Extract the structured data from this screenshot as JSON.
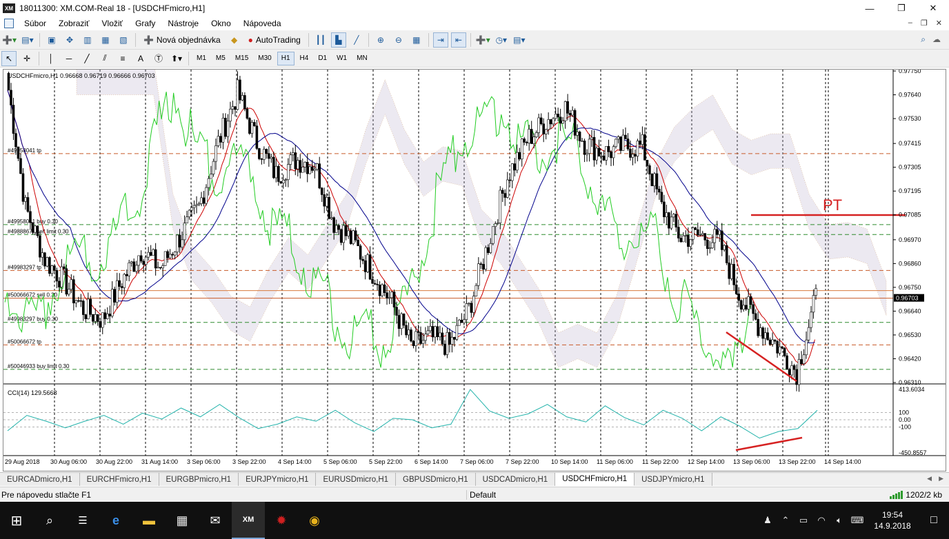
{
  "window": {
    "title": "18011300: XM.COM-Real 18 - [USDCHFmicro,H1]",
    "logo": "XM"
  },
  "menu": [
    "Súbor",
    "Zobraziť",
    "Vložiť",
    "Grafy",
    "Nástroje",
    "Okno",
    "Nápoveda"
  ],
  "toolbar": {
    "new_order": "Nová objednávka",
    "autotrading": "AutoTrading"
  },
  "timeframes": [
    "M1",
    "M5",
    "M15",
    "M30",
    "H1",
    "H4",
    "D1",
    "W1",
    "MN"
  ],
  "active_timeframe": "H1",
  "chart": {
    "header": "USDCHFmicro,H1  0.96668 0.96719 0.96666 0.96703",
    "current_price": "0.96703",
    "annotation_text": "PT",
    "price_ticks": [
      "0.97750",
      "0.97640",
      "0.97530",
      "0.97415",
      "0.97305",
      "0.97195",
      "0.97085",
      "0.96970",
      "0.96860",
      "0.96750",
      "0.96640",
      "0.96530",
      "0.96420",
      "0.96310"
    ],
    "time_ticks": [
      "29 Aug 2018",
      "30 Aug 06:00",
      "30 Aug 22:00",
      "31 Aug 14:00",
      "3 Sep 06:00",
      "3 Sep 22:00",
      "4 Sep 14:00",
      "5 Sep 06:00",
      "5 Sep 22:00",
      "6 Sep 14:00",
      "7 Sep 06:00",
      "7 Sep 22:00",
      "10 Sep 14:00",
      "11 Sep 06:00",
      "11 Sep 22:00",
      "12 Sep 14:00",
      "13 Sep 06:00",
      "13 Sep 22:00",
      "14 Sep 14:00"
    ],
    "order_labels": [
      "#49958041 tp",
      "#49958041 buy 0.30",
      "#49888677 sell limit 0.30",
      "#49983297 tp",
      "#50066672 sell 0.30",
      "#49983297 buy 0.30",
      "#50066672 tp",
      "#50046933 buy limit 0.30"
    ],
    "cci_header": "CCI(14) 129.5668",
    "cci_ticks": [
      "413.6034",
      "100",
      "0.00",
      "-100",
      "-450.8557"
    ],
    "colors": {
      "candle": "#000000",
      "tenkan": "#cc0000",
      "kijun": "#00008b",
      "chikou": "#22cc22",
      "cloud_a": "#d2a070",
      "cloud_b": "#b4a8c8",
      "cci": "#20b2aa",
      "annotation": "#d62222",
      "price_line": "#d87a3c"
    }
  },
  "chart_data": {
    "type": "line",
    "series": [
      {
        "values": [
          0.9774,
          0.9712,
          0.9688,
          0.9678,
          0.9665,
          0.966,
          0.9678,
          0.9692,
          0.9684,
          0.9698,
          0.9712,
          0.9742,
          0.9765,
          0.9742,
          0.9727,
          0.9734,
          0.9732,
          0.9705,
          0.9696,
          0.9682,
          0.9668,
          0.9648,
          0.9652,
          0.9648,
          0.9665,
          0.9695,
          0.9726,
          0.9743,
          0.9752,
          0.9758,
          0.9742,
          0.9737,
          0.974,
          0.974,
          0.9712,
          0.9698,
          0.9699,
          0.9696,
          0.9672,
          0.9658,
          0.9648,
          0.9636,
          0.967
        ]
      }
    ],
    "ylim": [
      0.9631,
      0.9775
    ],
    "cci": [
      -150,
      60,
      -20,
      -110,
      -20,
      60,
      -60,
      90,
      10,
      160,
      40,
      210,
      30,
      -120,
      -60,
      40,
      -20,
      130,
      -40,
      -160,
      20,
      0,
      -110,
      -60,
      413,
      120,
      20,
      80,
      210,
      40,
      -30,
      190,
      30,
      -70,
      130,
      20,
      -150,
      40,
      -90,
      -250,
      -160,
      -120,
      129
    ],
    "cci_ylim": [
      -450.8557,
      413.6034
    ]
  },
  "tabs": [
    "EURCADmicro,H1",
    "EURCHFmicro,H1",
    "EURGBPmicro,H1",
    "EURJPYmicro,H1",
    "EURUSDmicro,H1",
    "GBPUSDmicro,H1",
    "USDCADmicro,H1",
    "USDCHFmicro,H1",
    "USDJPYmicro,H1"
  ],
  "active_tab": "USDCHFmicro,H1",
  "status": {
    "help": "Pre nápovedu stlačte F1",
    "profile": "Default",
    "connection": "1202/2 kb"
  },
  "taskbar": {
    "time": "19:54",
    "date": "14.9.2018"
  }
}
